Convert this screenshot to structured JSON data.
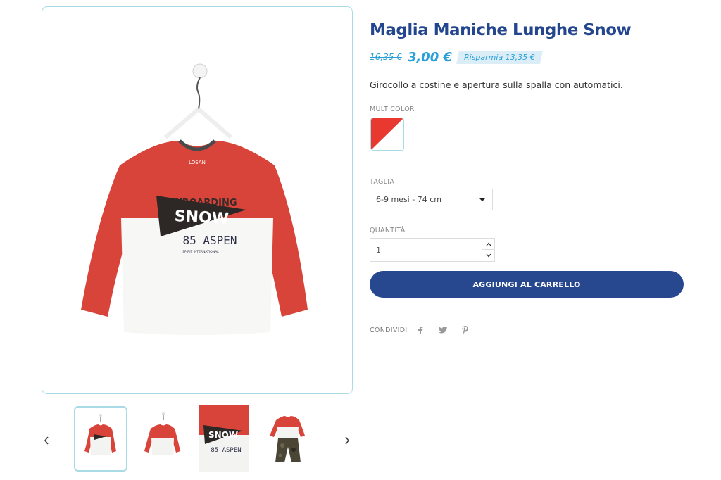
{
  "product": {
    "title": "Maglia Maniche Lunghe Snow",
    "old_price": "16,35 €",
    "price": "3,00 €",
    "savings": "Risparmia 13,35 €",
    "description": "Girocollo a costine e apertura sulla spalla con automatici."
  },
  "variant": {
    "color_label": "MULTICOLOR",
    "color_swatch": [
      "#e8382f",
      "#ffffff"
    ],
    "size_label": "TAGLIA",
    "size_value": "6-9 mesi - 74 cm",
    "qty_label": "QUANTITÀ",
    "qty_value": "1"
  },
  "cart": {
    "add_label": "AGGIUNGI AL CARRELLO"
  },
  "share": {
    "label": "CONDIVIDI",
    "icons": [
      "facebook-icon",
      "twitter-icon",
      "pinterest-icon"
    ]
  },
  "image_text": {
    "brand_tag": "LOSAN",
    "print_top": "HWBOARDING",
    "print_main": "SNOW",
    "print_bottom": "85 ASPEN",
    "print_small": "SPIRIT INTERNATIONAL"
  },
  "gallery": {
    "thumbnail_count": 4,
    "active_index": 0
  },
  "colors": {
    "brand_blue": "#27478f",
    "accent_blue": "#2a9fd8",
    "frame_border": "#a9dbe6",
    "shirt_red": "#d9443a"
  }
}
